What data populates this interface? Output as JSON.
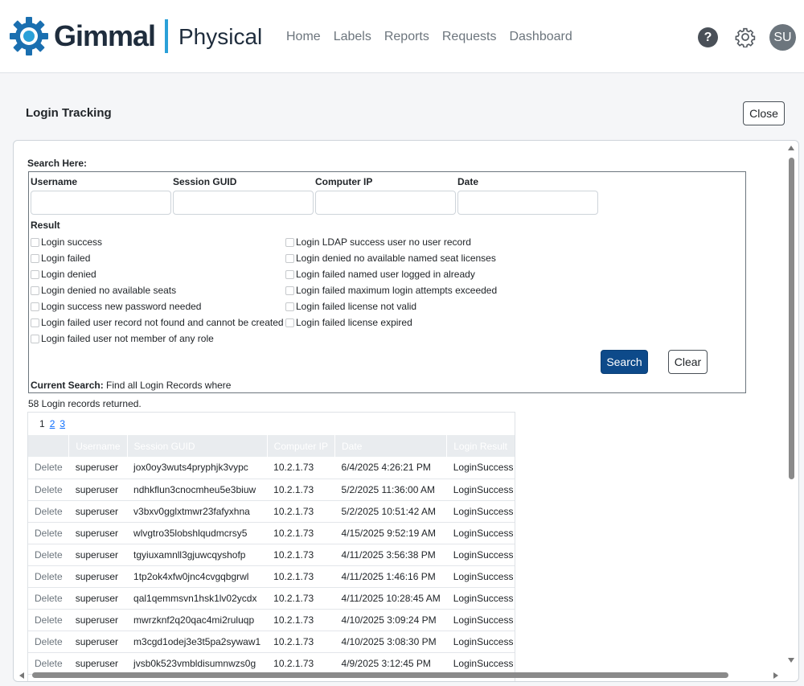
{
  "brand": {
    "name": "Gimmal",
    "product": "Physical",
    "accent_color": "#2aa0d8",
    "gear_color": "#1a6fb0"
  },
  "nav": {
    "items": [
      "Home",
      "Labels",
      "Reports",
      "Requests",
      "Dashboard"
    ]
  },
  "header_icons": {
    "help_glyph": "?",
    "avatar_initials": "SU"
  },
  "page": {
    "title": "Login Tracking",
    "close_label": "Close"
  },
  "search": {
    "heading": "Search Here:",
    "fields": [
      {
        "label": "Username",
        "value": ""
      },
      {
        "label": "Session GUID",
        "value": ""
      },
      {
        "label": "Computer IP",
        "value": ""
      },
      {
        "label": "Date",
        "value": ""
      }
    ],
    "result_label": "Result",
    "result_options_left": [
      "Login success",
      "Login failed",
      "Login denied",
      "Login denied no available seats",
      "Login success new password needed",
      "Login failed user record not found and cannot be created",
      "Login failed user not member of any role"
    ],
    "result_options_right": [
      "Login LDAP success user no user record",
      "Login denied no available named seat licenses",
      "Login failed named user logged in already",
      "Login failed maximum login attempts exceeded",
      "Login failed license not valid",
      "Login failed license expired"
    ],
    "search_label": "Search",
    "clear_label": "Clear",
    "current_search_label": "Current Search:",
    "current_search_text": "Find all Login Records where",
    "button_color": "#0d4a8a"
  },
  "results": {
    "count_text": "58 Login records returned.",
    "pages": [
      "1",
      "2",
      "3"
    ],
    "columns": [
      "",
      "Username",
      "Session GUID",
      "Computer IP",
      "Date",
      "Login Result"
    ],
    "delete_label": "Delete",
    "rows": [
      [
        "superuser",
        "jox0oy3wuts4pryphjk3vypc",
        "10.2.1.73",
        "6/4/2025 4:26:21 PM",
        "LoginSuccess"
      ],
      [
        "superuser",
        "ndhkflun3cnocmheu5e3biuw",
        "10.2.1.73",
        "5/2/2025 11:36:00 AM",
        "LoginSuccess"
      ],
      [
        "superuser",
        "v3bxv0gglxtmwr23fafyxhna",
        "10.2.1.73",
        "5/2/2025 10:51:42 AM",
        "LoginSuccess"
      ],
      [
        "superuser",
        "wlvgtro35lobshlqudmcrsy5",
        "10.2.1.73",
        "4/15/2025 9:52:19 AM",
        "LoginSuccess"
      ],
      [
        "superuser",
        "tgyiuxamnll3gjuwcqyshofp",
        "10.2.1.73",
        "4/11/2025 3:56:38 PM",
        "LoginSuccess"
      ],
      [
        "superuser",
        "1tp2ok4xfw0jnc4cvgqbgrwl",
        "10.2.1.73",
        "4/11/2025 1:46:16 PM",
        "LoginSuccess"
      ],
      [
        "superuser",
        "qal1qemmsvn1hsk1lv02ycdx",
        "10.2.1.73",
        "4/11/2025 10:28:45 AM",
        "LoginSuccess"
      ],
      [
        "superuser",
        "mwrzknf2q20qac4mi2ruluqp",
        "10.2.1.73",
        "4/10/2025 3:09:24 PM",
        "LoginSuccess"
      ],
      [
        "superuser",
        "m3cgd1odej3e3t5pa2sywaw1",
        "10.2.1.73",
        "4/10/2025 3:08:30 PM",
        "LoginSuccess"
      ],
      [
        "superuser",
        "jvsb0k523vmbldisumnwzs0g",
        "10.2.1.73",
        "4/9/2025 3:12:45 PM",
        "LoginSuccess"
      ]
    ]
  }
}
